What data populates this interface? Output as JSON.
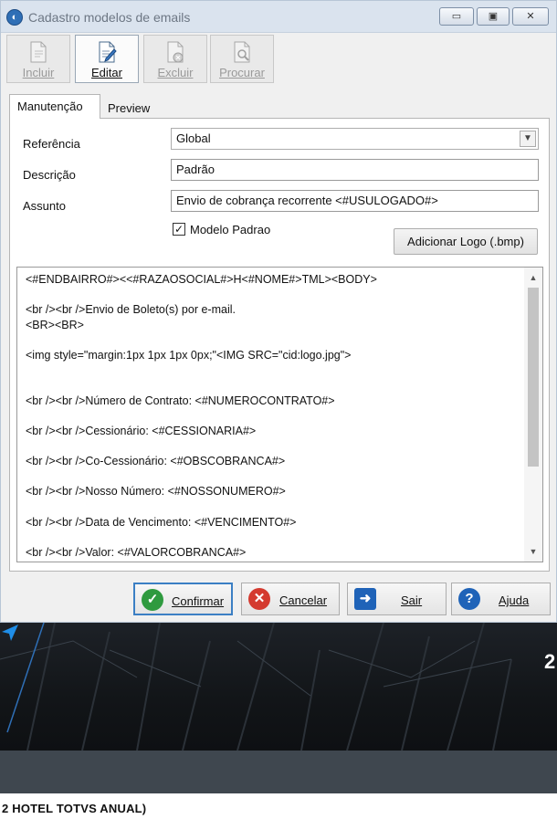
{
  "window": {
    "title": "Cadastro modelos de emails",
    "controls": {
      "minimize": "▭",
      "maximize": "▣",
      "close": "✕"
    }
  },
  "toolbar": {
    "incluir": "Incluir",
    "editar": "Editar",
    "excluir": "Excluir",
    "procurar": "Procurar"
  },
  "tabs": {
    "manutencao": "Manutenção",
    "preview": "Preview"
  },
  "form": {
    "referencia_label": "Referência",
    "referencia_value": "Global",
    "descricao_label": "Descrição",
    "descricao_value": "Padrão",
    "assunto_label": "Assunto",
    "assunto_value": "Envio de cobrança recorrente <#USULOGADO#>",
    "modelo_padrao_label": "Modelo Padrao",
    "modelo_padrao_checked": true,
    "adicionar_logo": "Adicionar Logo (.bmp)",
    "body_lines": [
      "<#ENDBAIRRO#><<#RAZAOSOCIAL#>H<#NOME#>TML><BODY>",
      "",
      "<br /><br />Envio de Boleto(s) por e-mail.",
      "<BR><BR>",
      "",
      "<img style=\"margin:1px 1px 1px 0px;\"<IMG SRC=\"cid:logo.jpg\">",
      "",
      "",
      "<br /><br />Número de Contrato: <#NUMEROCONTRATO#>",
      "",
      "<br /><br />Cessionário: <#CESSIONARIA#>",
      "",
      "<br /><br />Co-Cessionário: <#OBSCOBRANCA#>",
      "",
      "<br /><br />Nosso Número: <#NOSSONUMERO#>",
      "",
      "<br /><br />Data de Vencimento: <#VENCIMENTO#>",
      "",
      "<br /><br />Valor: <#VALORCOBRANCA#>"
    ]
  },
  "actions": {
    "confirmar": "Confirmar",
    "cancelar": "Cancelar",
    "sair": "Sair",
    "ajuda": "Ajuda"
  },
  "background": {
    "partial_number": "2",
    "strip_text": "2 HOTEL TOTVS ANUAL)"
  },
  "colors": {
    "titlebar": "#dae3ee",
    "confirm_focus": "#3b7fc4",
    "confirm_icon": "#2f9a3f",
    "cancel_icon": "#d43a2f",
    "info_icon": "#1f63b8"
  }
}
